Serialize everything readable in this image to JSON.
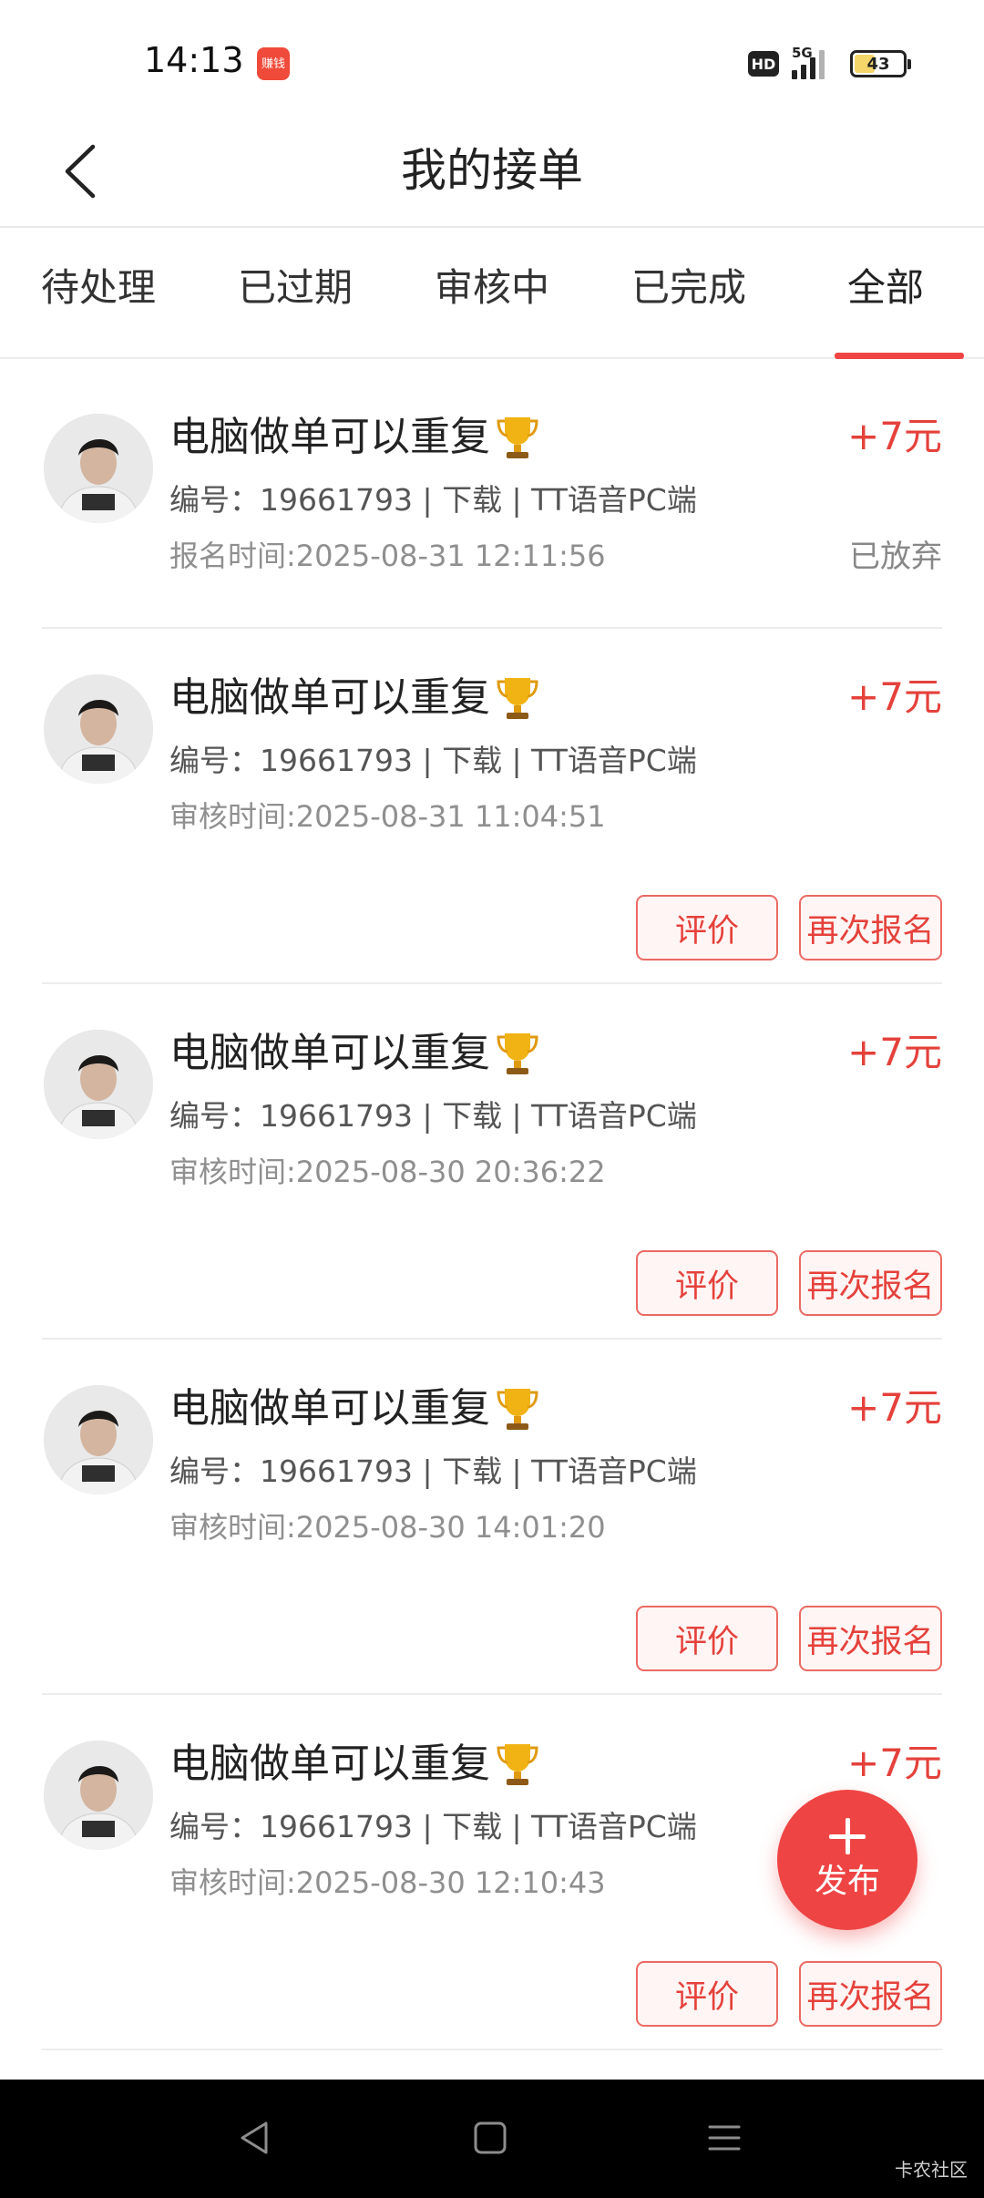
{
  "status_bar": {
    "time": "14:13",
    "app_badge": "赚钱",
    "hd": "HD",
    "network": "5G",
    "battery_level": "43",
    "battery_fill_color": "#f5d66b"
  },
  "header": {
    "title": "我的接单"
  },
  "tabs": [
    {
      "label": "待处理",
      "active": false
    },
    {
      "label": "已过期",
      "active": false
    },
    {
      "label": "审核中",
      "active": false
    },
    {
      "label": "已完成",
      "active": false
    },
    {
      "label": "全部",
      "active": true
    }
  ],
  "orders": [
    {
      "title": "电脑做单可以重复",
      "reward": "+7元",
      "meta": "编号：19661793 | 下载 | TT语音PC端",
      "time": "报名时间:2025-08-31 12:11:56",
      "status": "已放弃"
    },
    {
      "title": "电脑做单可以重复",
      "reward": "+7元",
      "meta": "编号：19661793 | 下载 | TT语音PC端",
      "time": "审核时间:2025-08-31 11:04:51",
      "button_rate": "评价",
      "button_reapply": "再次报名"
    },
    {
      "title": "电脑做单可以重复",
      "reward": "+7元",
      "meta": "编号：19661793 | 下载 | TT语音PC端",
      "time": "审核时间:2025-08-30 20:36:22",
      "button_rate": "评价",
      "button_reapply": "再次报名"
    },
    {
      "title": "电脑做单可以重复",
      "reward": "+7元",
      "meta": "编号：19661793 | 下载 | TT语音PC端",
      "time": "审核时间:2025-08-30 14:01:20",
      "button_rate": "评价",
      "button_reapply": "再次报名"
    },
    {
      "title": "电脑做单可以重复",
      "reward": "+7元",
      "meta": "编号：19661793 | 下载 | TT语音PC端",
      "time": "审核时间:2025-08-30 12:10:43",
      "button_rate": "评价",
      "button_reapply": "再次报名"
    }
  ],
  "fab": {
    "label": "发布"
  },
  "watermark": "卡农社区",
  "colors": {
    "accent": "#ef4444",
    "reward": "#e5413b",
    "button_border": "#ea6a63",
    "button_bg": "#fff5f4",
    "nav_bar": "#000000"
  },
  "icons": {
    "back": "chevron-left-icon",
    "trophy": "trophy-icon",
    "plus": "plus-icon",
    "nav_back": "triangle-back-icon",
    "nav_home": "square-home-icon",
    "nav_menu": "menu-lines-icon"
  }
}
